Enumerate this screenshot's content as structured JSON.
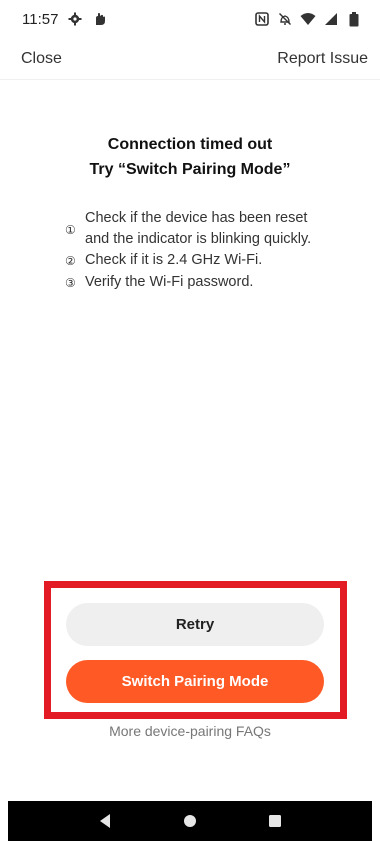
{
  "status_bar": {
    "time": "11:57",
    "left_icons": [
      "gear-icon",
      "notification-hand-icon"
    ],
    "right_icons": [
      "nfc-icon",
      "vibrate-off-icon",
      "wifi-icon",
      "signal-icon",
      "battery-icon"
    ]
  },
  "nav": {
    "close_label": "Close",
    "report_label": "Report Issue"
  },
  "content": {
    "title_line1": "Connection timed out",
    "title_line2": "Try “Switch Pairing Mode”",
    "steps": [
      {
        "num": "①",
        "text_line1": "Check if the device has been reset",
        "text_line2": "and the indicator is blinking quickly."
      },
      {
        "num": "②",
        "text": "Check if it is 2.4 GHz Wi-Fi."
      },
      {
        "num": "③",
        "text": "Verify the Wi-Fi password."
      }
    ]
  },
  "actions": {
    "retry_label": "Retry",
    "switch_label": "Switch Pairing Mode",
    "faq_label": "More device-pairing FAQs"
  },
  "colors": {
    "primary": "#ff5a26",
    "highlight": "#e21b24",
    "secondary_button": "#efefef"
  },
  "system_nav": {
    "back_icon": "back-icon",
    "home_icon": "home-icon",
    "recents_icon": "recents-icon"
  }
}
